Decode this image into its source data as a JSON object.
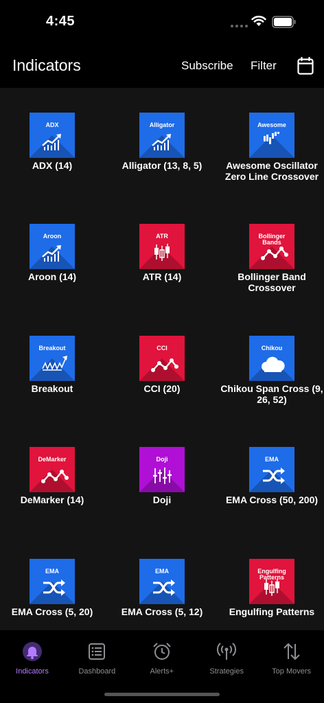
{
  "status": {
    "time": "4:45"
  },
  "header": {
    "title": "Indicators",
    "subscribe": "Subscribe",
    "filter": "Filter"
  },
  "colors": {
    "blue": "#1e6ce8",
    "red": "#e0143c",
    "purple": "#b00fd6",
    "active": "#b57bff",
    "inactive": "#8e8e93"
  },
  "indicators": [
    {
      "tile": "ADX",
      "name": "ADX (14)",
      "color": "blue",
      "icon": "rising-chart-icon"
    },
    {
      "tile": "Alligator",
      "name": "Alligator (13, 8, 5)",
      "color": "blue",
      "icon": "rising-chart-icon"
    },
    {
      "tile": "Awesome",
      "name": "Awesome Oscillator Zero Line Crossover",
      "color": "blue",
      "icon": "histogram-icon"
    },
    {
      "tile": "Aroon",
      "name": "Aroon (14)",
      "color": "blue",
      "icon": "rising-chart-icon"
    },
    {
      "tile": "ATR",
      "name": "ATR (14)",
      "color": "red",
      "icon": "candlestick-icon"
    },
    {
      "tile": "Bollinger Bands",
      "name": "Bollinger Band Crossover",
      "color": "red",
      "icon": "zigzag-line-icon"
    },
    {
      "tile": "Breakout",
      "name": "Breakout",
      "color": "blue",
      "icon": "breakout-line-icon"
    },
    {
      "tile": "CCI",
      "name": "CCI (20)",
      "color": "red",
      "icon": "zigzag-line-icon"
    },
    {
      "tile": "Chikou",
      "name": "Chikou Span Cross (9, 26, 52)",
      "color": "blue",
      "icon": "cloud-icon"
    },
    {
      "tile": "DeMarker",
      "name": "DeMarker (14)",
      "color": "red",
      "icon": "zigzag-line-icon"
    },
    {
      "tile": "Doji",
      "name": "Doji",
      "color": "purple",
      "icon": "doji-candles-icon"
    },
    {
      "tile": "EMA",
      "name": "EMA Cross (50, 200)",
      "color": "blue",
      "icon": "shuffle-icon"
    },
    {
      "tile": "EMA",
      "name": "EMA Cross (5, 20)",
      "color": "blue",
      "icon": "shuffle-icon"
    },
    {
      "tile": "EMA",
      "name": "EMA Cross (5, 12)",
      "color": "blue",
      "icon": "shuffle-icon"
    },
    {
      "tile": "Engulfing Patterns",
      "name": "Engulfing Patterns",
      "color": "red",
      "icon": "candlestick-icon"
    }
  ],
  "tabs": [
    {
      "label": "Indicators",
      "icon": "bell-icon",
      "active": true
    },
    {
      "label": "Dashboard",
      "icon": "list-icon",
      "active": false
    },
    {
      "label": "Alerts+",
      "icon": "alarm-clock-icon",
      "active": false
    },
    {
      "label": "Strategies",
      "icon": "broadcast-icon",
      "active": false
    },
    {
      "label": "Top Movers",
      "icon": "up-down-arrows-icon",
      "active": false
    }
  ]
}
